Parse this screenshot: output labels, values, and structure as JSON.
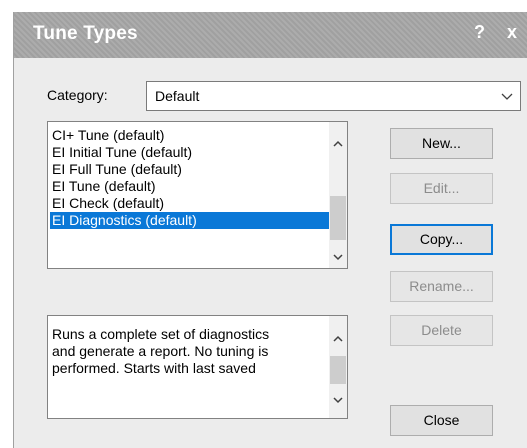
{
  "window": {
    "title": "Tune Types",
    "help_glyph": "?",
    "close_glyph": "x"
  },
  "category": {
    "label": "Category:",
    "value": "Default"
  },
  "tune_list": {
    "items": [
      {
        "label": "CI+ Tune (default)",
        "selected": false
      },
      {
        "label": "EI Initial Tune (default)",
        "selected": false
      },
      {
        "label": "EI Full Tune (default)",
        "selected": false
      },
      {
        "label": "EI Tune (default)",
        "selected": false
      },
      {
        "label": "EI Check (default)",
        "selected": false
      },
      {
        "label": "EI Diagnostics (default)",
        "selected": true
      }
    ]
  },
  "description": {
    "lines": [
      "Runs a complete set of diagnostics",
      "and generate a report. No tuning is",
      "performed. Starts with last saved"
    ]
  },
  "buttons": {
    "new": "New...",
    "edit": "Edit...",
    "copy": "Copy...",
    "rename": "Rename...",
    "delete": "Delete",
    "close": "Close"
  },
  "colors": {
    "selection": "#0a78d7",
    "titlebar": "#a7a7a7",
    "disabled_text": "#8c8c8c"
  }
}
